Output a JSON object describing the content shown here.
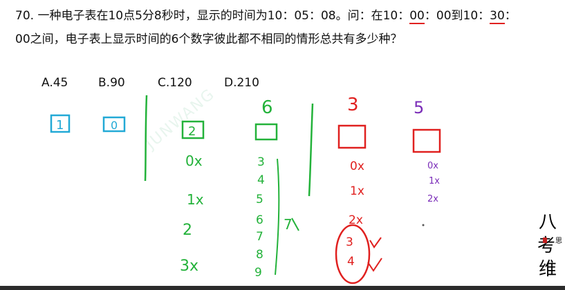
{
  "question": {
    "line1_a": "70. 一种电子表在10点5分8秒时，显示的时间为10：05：08。问：在10：",
    "line1_b": "00",
    "line1_c": "：00到10：",
    "line1_d": "30",
    "line1_e": "：",
    "line2": "00之间，电子表上显示时间的6个数字彼此都不相同的情形总共有多少种？"
  },
  "options": [
    "A.45",
    "B.90",
    "C.120",
    "D.210"
  ],
  "notes": {
    "blue_1": "1",
    "blue_0": "0",
    "col2_top": "2",
    "col2_items": [
      "0x",
      "1x",
      "2",
      "3x"
    ],
    "col3_head": "6",
    "col3_items": [
      "3",
      "4",
      "5",
      "6",
      "7",
      "8",
      "9"
    ],
    "col3_count": "7",
    "col4_head": "3",
    "col4_items": [
      "0x",
      "1x",
      "2x",
      "3",
      "4"
    ],
    "col5_head": "5",
    "col5_items": [
      "0x",
      "1x",
      "2x"
    ]
  },
  "watermark": "JUNWANG",
  "logo": {
    "chars": [
      "八",
      "考",
      "维"
    ],
    "small": "思"
  },
  "colors": {
    "blue": "#22a9d6",
    "green": "#23b23a",
    "red": "#e0201f",
    "purple": "#7a2cb8",
    "red_underline": "#e0201f"
  }
}
